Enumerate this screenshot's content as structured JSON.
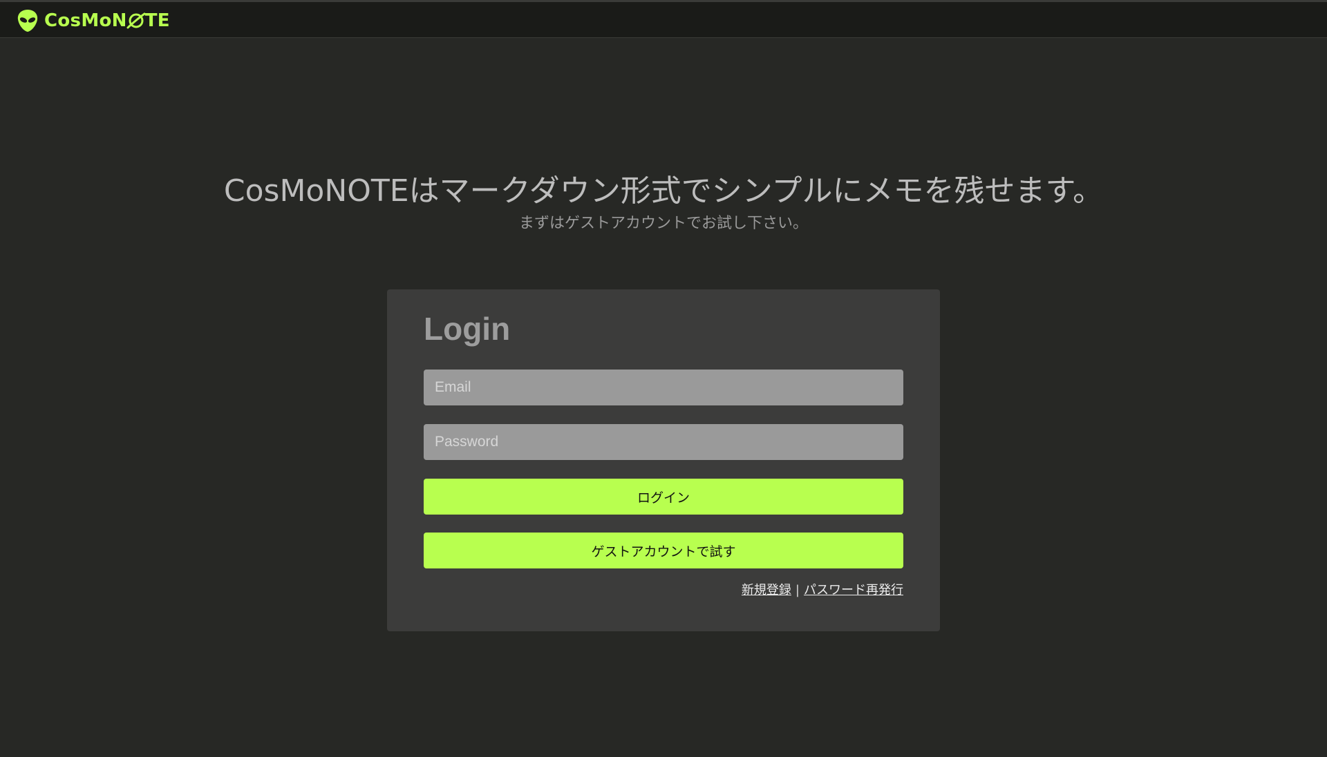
{
  "header": {
    "logo_text_pre": "CosMoN",
    "logo_text_post": "TE",
    "logo_icon": "alien-icon",
    "logo_o_icon": "planet-icon",
    "accent_color": "#b8ff4f"
  },
  "hero": {
    "title": "CosMoNOTEはマークダウン形式でシンプルにメモを残せます。",
    "subtitle": "まずはゲストアカウントでお試し下さい。"
  },
  "login": {
    "title": "Login",
    "email_placeholder": "Email",
    "email_value": "",
    "password_placeholder": "Password",
    "password_value": "",
    "login_button": "ログイン",
    "guest_button": "ゲストアカウントで試す",
    "register_link": "新規登録",
    "separator": "|",
    "reset_link": "パスワード再発行"
  }
}
